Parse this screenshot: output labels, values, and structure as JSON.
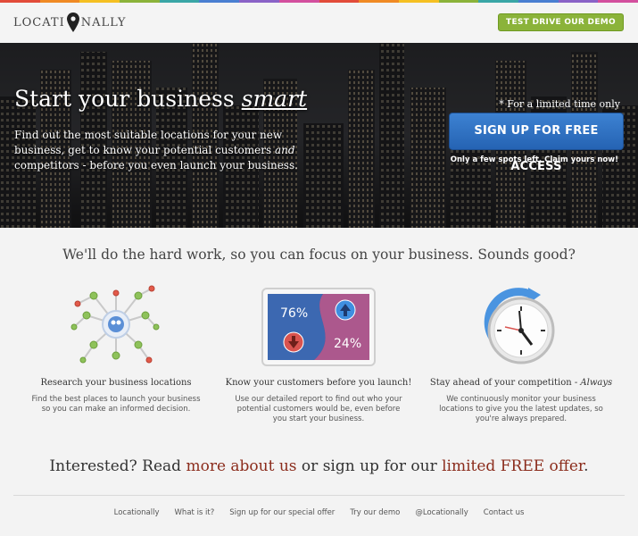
{
  "brand": {
    "logo_left": "LOCATI",
    "logo_right": "NALLY",
    "rainbow": [
      "#e24c3a",
      "#f08a24",
      "#f5c022",
      "#8bb33a",
      "#3aa6a6",
      "#4a7fd1",
      "#8a63c7",
      "#d34f9e",
      "#e24c3a",
      "#f08a24",
      "#f5c022",
      "#8bb33a",
      "#3aa6a6",
      "#4a7fd1",
      "#8a63c7",
      "#d34f9e"
    ]
  },
  "header": {
    "test_drive": "TEST DRIVE OUR DEMO"
  },
  "hero": {
    "title_pre": "Start your business ",
    "title_em": "smart",
    "desc_1": "Find out the most suitable locations for your new business, get to know your potential customers ",
    "desc_em": "and",
    "desc_2": " competitors - before you even launch your business.",
    "limited": "* For a limited time only",
    "signup": "SIGN UP FOR FREE ACCESS",
    "spots": "Only a few spots left. Claim yours now!"
  },
  "tagline": "We'll do the hard work, so you can focus on your business. Sounds good?",
  "features": [
    {
      "icon": "network-icon",
      "title": "Research your business locations",
      "title_em": "",
      "desc": "Find the best places to launch your business so you can make an informed decision."
    },
    {
      "icon": "report-icon",
      "title": "Know your customers before you launch!",
      "title_em": "",
      "desc": "Use our detailed report to find out who your potential customers would be, even before you start your business.",
      "stat_up": "76%",
      "stat_down": "24%"
    },
    {
      "icon": "clock-icon",
      "title": "Stay ahead of your competition - ",
      "title_em": "Always",
      "desc": "We continuously monitor your business locations to give you the latest updates, so you're always prepared."
    }
  ],
  "cta": {
    "pre": "Interested? Read ",
    "link1": "more about us",
    "mid": " or sign up for our ",
    "link2": "limited FREE offer",
    "post": "."
  },
  "footer": [
    "Locationally",
    "What is it?",
    "Sign up for our special offer",
    "Try our demo",
    "@Locationally",
    "Contact us"
  ],
  "colors": {
    "accent_green": "#8bb33a",
    "signup_blue": "#2f6fc2",
    "link_red": "#8b2c1c"
  }
}
